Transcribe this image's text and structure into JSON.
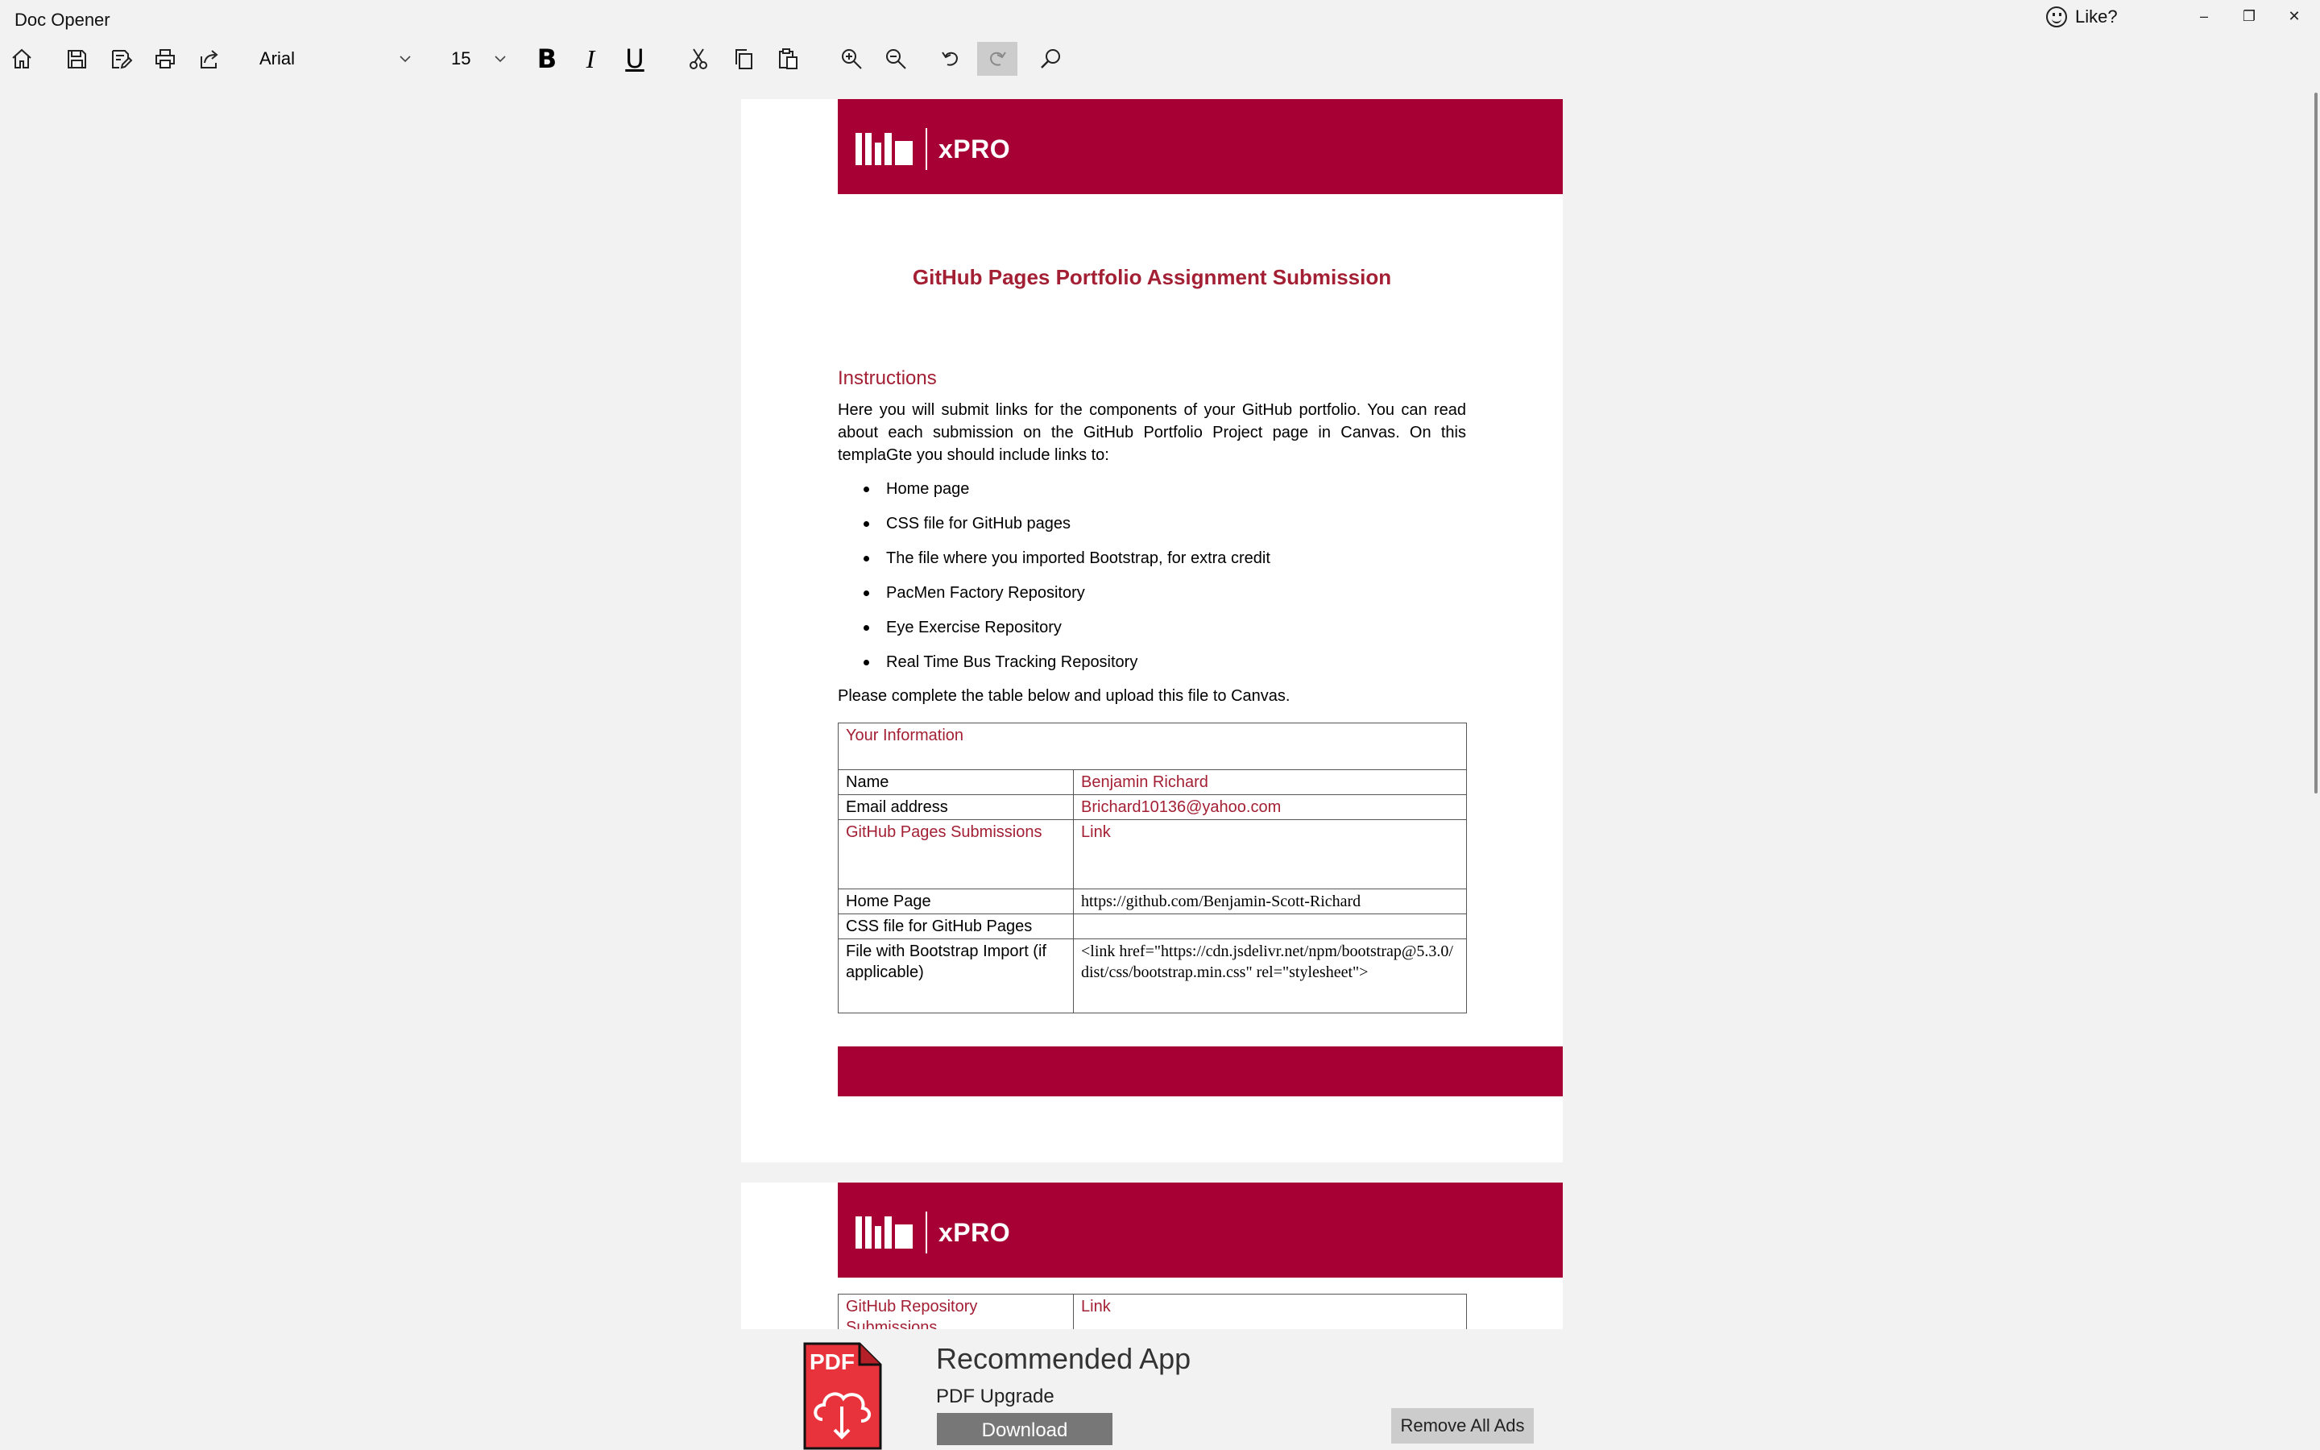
{
  "window": {
    "title": "Doc Opener",
    "like_label": "Like?",
    "minimize": "–",
    "restore": "❐",
    "close": "✕"
  },
  "toolbar": {
    "font_family": "Arial",
    "font_size": "15",
    "bold": "B",
    "italic": "I",
    "underline": "U"
  },
  "page1": {
    "logo_text": "xPRO",
    "title": "GitHub Pages Portfolio Assignment Submission",
    "instructions_heading": "Instructions",
    "intro": "Here you will submit links for the components of your GitHub portfolio. You can read about each submission on the GitHub Portfolio Project page in Canvas. On this templaGte you should include links to:",
    "bullets": [
      "Home page",
      "CSS file for GitHub pages",
      "The file where you imported Bootstrap, for extra credit",
      "PacMen Factory Repository",
      "Eye Exercise Repository",
      "Real Time Bus Tracking Repository"
    ],
    "outro": "Please complete the table below and upload this file to Canvas.",
    "table": {
      "header": "Your Information",
      "name_label": "Name",
      "name_value": "Benjamin Richard",
      "email_label": "Email address",
      "email_value": "Brichard10136@yahoo.com",
      "gh_label": "GitHub Pages Submissions",
      "gh_link": "Link",
      "home_label": "Home Page",
      "home_value": "https://github.com/Benjamin-Scott-Richard",
      "css_label": "CSS file for GitHub Pages",
      "css_value": "",
      "bootstrap_label": "File with Bootstrap Import (if applicable)",
      "bootstrap_value": "<link href=\"https://cdn.jsdelivr.net/npm/bootstrap@5.3.0/dist/css/bootstrap.min.css\" rel=\"stylesheet\">"
    }
  },
  "page2": {
    "logo_text": "xPRO",
    "table": {
      "repo_label": "GitHub Repository Submissions",
      "repo_link": "Link"
    }
  },
  "ad": {
    "icon_label": "PDF",
    "heading": "Recommended App",
    "app_name": "PDF Upgrade",
    "download_label": "Download",
    "remove_label": "Remove All Ads"
  },
  "colors": {
    "brand": "#a60034",
    "heading_red": "#a31f34",
    "pdf_red": "#e8333c"
  }
}
